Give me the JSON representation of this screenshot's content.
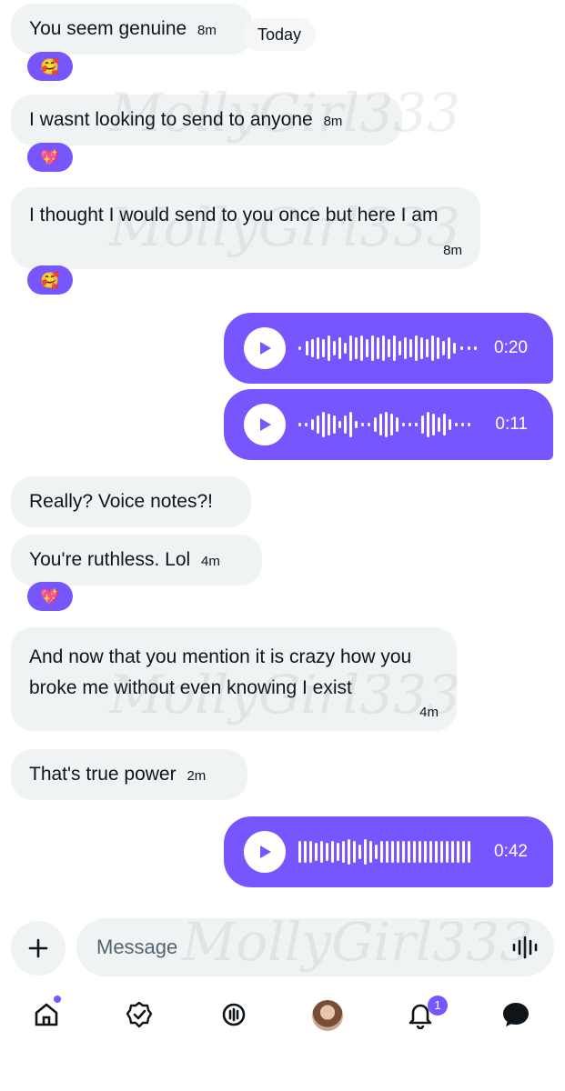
{
  "colors": {
    "accent": "#7856ff",
    "bubble_bg": "#eff3f4",
    "text": "#0f1419",
    "muted": "#536471"
  },
  "messages": [
    {
      "text": "You seem genuine",
      "time": "8m",
      "reaction": "smiling-face-with-hearts"
    },
    {
      "text": "I wasnt looking to send to anyone",
      "time": "8m",
      "reaction": "sparkling-heart"
    },
    {
      "text": "I thought I would send to you once but here I am",
      "time": "8m",
      "reaction": "smiling-face-with-hearts"
    },
    {
      "text": "Really? Voice notes?!",
      "time": ""
    },
    {
      "text": "You're ruthless. Lol",
      "time": "4m",
      "reaction": "sparkling-heart"
    },
    {
      "text": "And now that you mention it is crazy how you broke me without even knowing I exist",
      "time": "4m"
    },
    {
      "text": "That's true power",
      "time": "2m"
    }
  ],
  "date_separator": "Today",
  "voice_notes": [
    {
      "duration": "0:20"
    },
    {
      "duration": "0:11"
    },
    {
      "duration": "0:42"
    }
  ],
  "composer": {
    "placeholder": "Message"
  },
  "watermark": "MollyGirl333",
  "nav": {
    "items": [
      "home-icon",
      "verified-icon",
      "grok-icon",
      "profile-avatar",
      "notifications-icon",
      "messages-icon"
    ],
    "notification_count": "1"
  },
  "reaction_glyphs": {
    "smiling-face-with-hearts": "🥰",
    "sparkling-heart": "💖"
  }
}
